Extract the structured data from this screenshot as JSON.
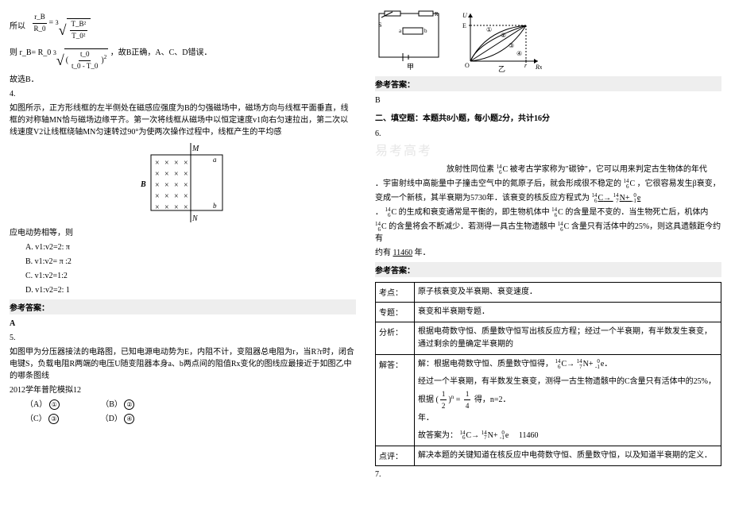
{
  "left": {
    "line_soyi": "所以",
    "formula1_lhs_num": "r_B",
    "formula1_lhs_den": "R_0",
    "formula1_root_idx": "3",
    "formula1_rhs_num": "T_B²",
    "formula1_rhs_den": "T_0²",
    "line_ze": "则",
    "formula2_lhs": "r_B=",
    "formula2_base": "R_0",
    "formula2_idx": "3",
    "formula2_frac_num": "t_0",
    "formula2_frac_den": "t_0 - T_0",
    "formula2_exp": "2",
    "formula2_tail": "，故B正确，A、C、D错误．",
    "line_guxuan": "故选B．",
    "q4_num": "4.",
    "q4_p1": "如图所示，正方形线框的左半侧处在磁感应强度为B的匀强磁场中，磁场方向与线框平面垂直，线框的对称轴MN恰与磁场边缘平齐。第一次将线框从磁场中以恒定速度v1向右匀速拉出，第二次以线速度V2让线框绕轴MN匀速转过90°为使两次操作过程中，线框产生的平均感",
    "fig_M": "M",
    "fig_N": "N",
    "fig_B": "B",
    "fig_a": "a",
    "fig_b": "b",
    "q4_p2": "应电动势相等，则",
    "q4_optA": "A. v1:v2=2: π",
    "q4_optB": "B. v1:v2= π :2",
    "q4_optC": "C. v1:v2=1:2",
    "q4_optD": "D. v1:v2=2: 1",
    "ans_label": "参考答案：",
    "q4_ans": "A",
    "q5_num": "5.",
    "q5_p1": "如图甲为分压器接法的电路图，已知电源电动势为E，内阻不计，变阻器总电阻为r，当R?r时，闭合电键S，负载电阻R两端的电压U随变阻器本身a、b两点间的阻值Rx变化的图线应最接近于如图乙中的哪条图线",
    "q5_src": "2012学年普陀模拟12",
    "q5_A": "（A）",
    "q5_A_opt": "①",
    "q5_B": "（B）",
    "q5_B_opt": "②",
    "q5_C": "（C）",
    "q5_C_opt": "③",
    "q5_D": "（D）",
    "q5_D_opt": "④"
  },
  "right": {
    "circ_s": "S",
    "circ_a": "a",
    "circ_b": "b",
    "circ_R": "R",
    "circ_U": "U",
    "circ_E": "E",
    "circ_O": "O",
    "circ_r": "r",
    "circ_Rx": "Rx",
    "circ_1": "①",
    "circ_2": "②",
    "circ_3": "③",
    "circ_4": "④",
    "circ_jia": "甲",
    "circ_yi": "乙",
    "ans_label": "参考答案：",
    "q5_ans": "B",
    "sec2": "二、填空题：本题共8小题，每小题2分，共计16分",
    "q6_num": "6.",
    "watermark": "易考高考",
    "q6_p1_a": "放射性同位素",
    "iso_c14_top": "14",
    "iso_c14_bot": "6",
    "iso_c14_sym": "C",
    "q6_p1_b": "被考古学家称为\"碳钟\"，它可以用来判定古生物体的年代",
    "q6_p2_a": "．宇宙射线中高能量中子撞击空气中的氮原子后，就会形成很不稳定的",
    "q6_p2_b": "，它很容易发生β衰变，",
    "q6_p3_a": "变成一个新核，其半衰期为5730年．该衰变的核反应方程式为",
    "iso_n14_top": "14",
    "iso_n14_bot": "7",
    "iso_n14_sym": "N",
    "iso_e_top": "0",
    "iso_e_bot": "-1",
    "iso_e_sym": "e",
    "q6_p4_a": "．",
    "q6_p4_b": "的生成和衰变通常是平衡的，即生物机体中",
    "q6_p4_c": "的含量是不变的．当生物死亡后，机体内",
    "q6_p5_a": "的含量将会不断减少．若测得一具古生物遗骸中",
    "q6_p5_b": "含量只有活体中的25%，则这具遗骸距今约有",
    "q6_blank": "11460",
    "q6_p5_c": "年．",
    "table": {
      "kd_label": "考点：",
      "kd_text": "原子核衰变及半衰期、衰变速度．",
      "zt_label": "专题：",
      "zt_text": "衰变和半衰期专题．",
      "fx_label": "分析：",
      "fx_text": "根据电荷数守恒、质量数守恒写出核反应方程；经过一个半衰期，有半数发生衰变，通过剩余的量确定半衰期的",
      "jd_label": "解答：",
      "jd_l1": "解：根据电荷数守恒、质量数守恒得，",
      "jd_l2a": "经过一个半衰期，有半数发生衰变，测得一古生物遗骸中的C含量只有活体中的25%，根据",
      "jd_l2_frac_num": "1",
      "jd_l2_frac_den": "2",
      "jd_l2_exp": "n",
      "jd_l2_eq": "=",
      "jd_l2_rhs_den": "4",
      "jd_l2b": "得，n=2．",
      "jd_l3": "年．",
      "jd_l4a": "故答案为：",
      "jd_l4b": "11460",
      "dp_label": "点评：",
      "dp_text": "解决本题的关键知道在核反应中电荷数守恒、质量数守恒，以及知道半衰期的定义．"
    },
    "q7_num": "7."
  }
}
